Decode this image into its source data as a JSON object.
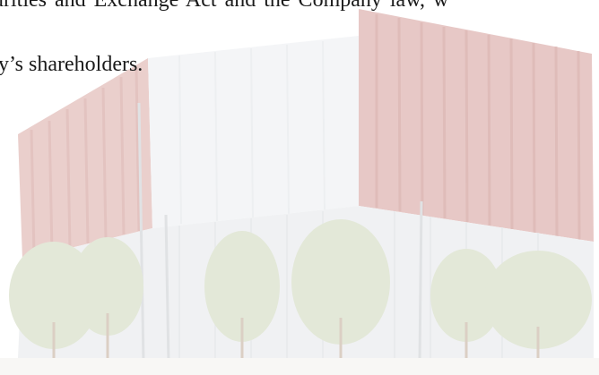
{
  "document": {
    "line1": "urities and Exchange Act and the Company law, w",
    "line2": "y’s shareholders."
  },
  "colors": {
    "text": "#1a1a1a",
    "facade_red": "#c98b86",
    "glass": "#e7e9ec",
    "trees": "#c9d4b4"
  }
}
